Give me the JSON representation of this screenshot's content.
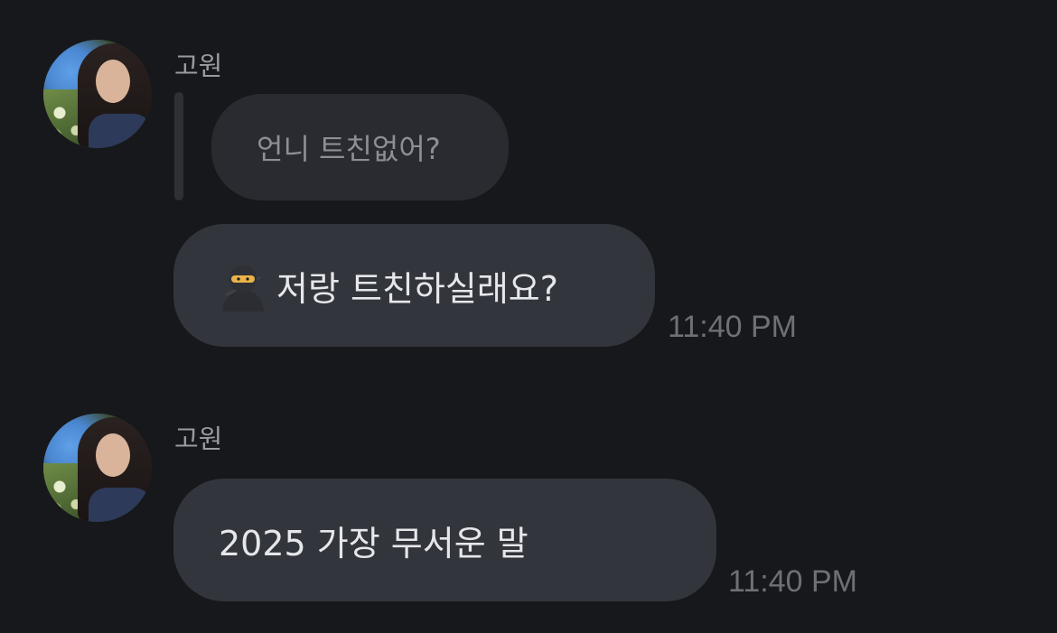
{
  "messages": [
    {
      "sender": "고원",
      "reply_to": "언니 트친없어?",
      "text": "저랑 트친하실래요?",
      "emoji": "🥷",
      "emoji_name": "ninja-icon",
      "time": "11:40 PM"
    },
    {
      "sender": "고원",
      "text": "2025 가장 무서운 말",
      "time": "11:40 PM"
    }
  ],
  "colors": {
    "background": "#17181c",
    "bubble": "#33353c",
    "reply_bubble": "#2a2b31",
    "sender_text": "#9a9ba0",
    "time_text": "#6f7075"
  }
}
